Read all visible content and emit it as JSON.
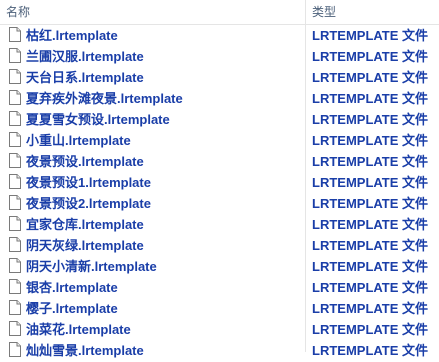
{
  "columns": {
    "name": "名称",
    "type": "类型"
  },
  "colors": {
    "text": "#1a3ea8",
    "header_text": "#4c607a",
    "divider": "#e5e5e5"
  },
  "files": [
    {
      "name": "枯红.lrtemplate",
      "type": "LRTEMPLATE 文件",
      "icon": "file-icon"
    },
    {
      "name": "兰圃汉服.lrtemplate",
      "type": "LRTEMPLATE 文件",
      "icon": "file-icon"
    },
    {
      "name": "天台日系.lrtemplate",
      "type": "LRTEMPLATE 文件",
      "icon": "file-icon"
    },
    {
      "name": "夏弃疾外滩夜景.lrtemplate",
      "type": "LRTEMPLATE 文件",
      "icon": "file-icon"
    },
    {
      "name": "夏夏雪女预设.lrtemplate",
      "type": "LRTEMPLATE 文件",
      "icon": "file-icon"
    },
    {
      "name": "小重山.lrtemplate",
      "type": "LRTEMPLATE 文件",
      "icon": "file-icon"
    },
    {
      "name": "夜景预设.lrtemplate",
      "type": "LRTEMPLATE 文件",
      "icon": "file-icon"
    },
    {
      "name": "夜景预设1.lrtemplate",
      "type": "LRTEMPLATE 文件",
      "icon": "file-icon"
    },
    {
      "name": "夜景预设2.lrtemplate",
      "type": "LRTEMPLATE 文件",
      "icon": "file-icon"
    },
    {
      "name": "宜家仓库.lrtemplate",
      "type": "LRTEMPLATE 文件",
      "icon": "file-icon"
    },
    {
      "name": "阴天灰绿.lrtemplate",
      "type": "LRTEMPLATE 文件",
      "icon": "file-icon"
    },
    {
      "name": "阴天小清新.lrtemplate",
      "type": "LRTEMPLATE 文件",
      "icon": "file-icon"
    },
    {
      "name": "银杏.lrtemplate",
      "type": "LRTEMPLATE 文件",
      "icon": "file-icon"
    },
    {
      "name": "樱子.lrtemplate",
      "type": "LRTEMPLATE 文件",
      "icon": "file-icon"
    },
    {
      "name": "油菜花.lrtemplate",
      "type": "LRTEMPLATE 文件",
      "icon": "file-icon"
    },
    {
      "name": "灿灿雪景.lrtemplate",
      "type": "LRTEMPLATE 文件",
      "icon": "file-icon"
    }
  ]
}
